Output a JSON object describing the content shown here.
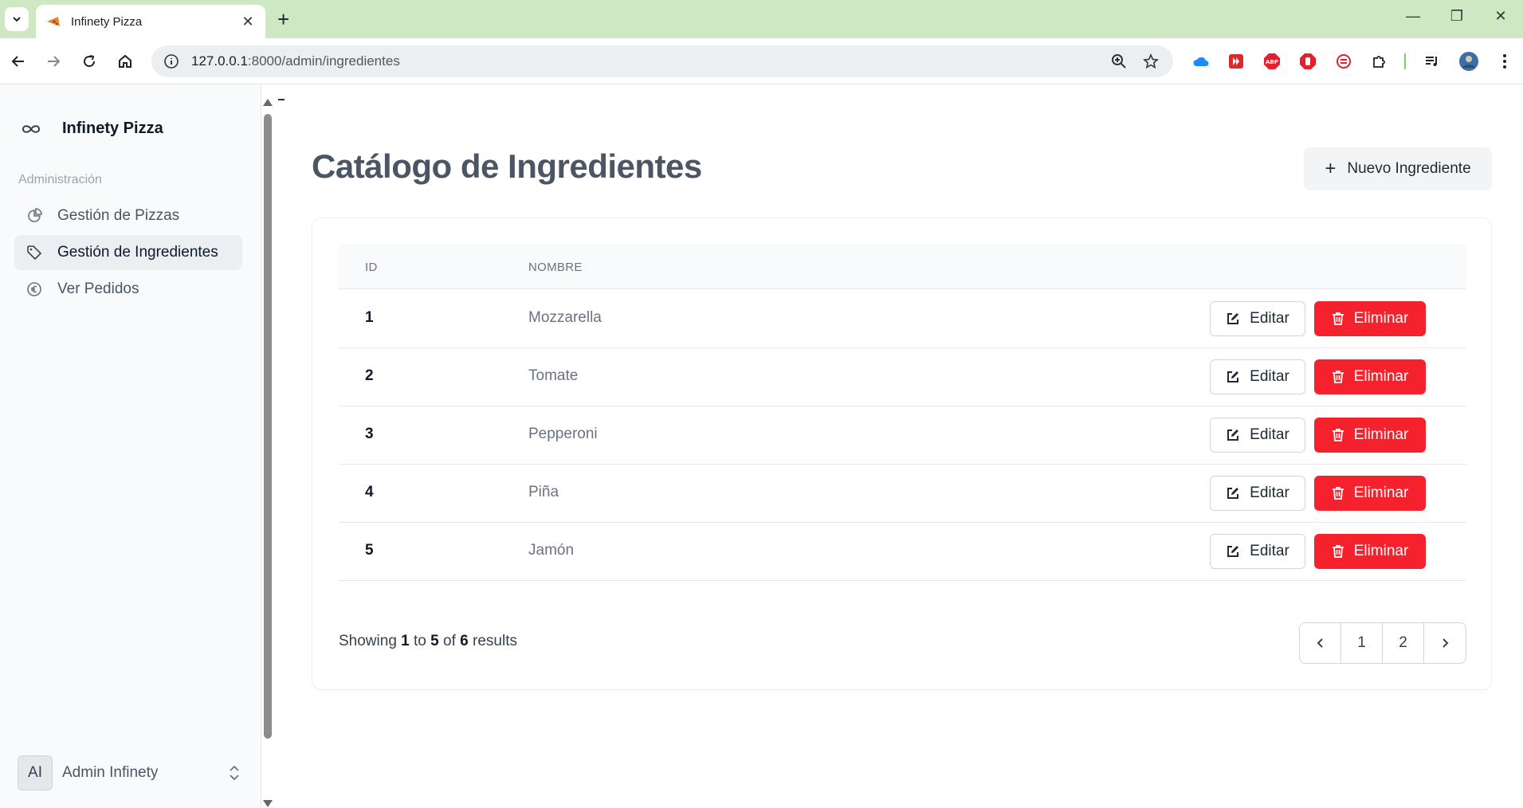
{
  "browser": {
    "tab_title": "Infinety Pizza",
    "url_host": "127.0.0.1",
    "url_path": ":8000/admin/ingredientes"
  },
  "sidebar": {
    "brand": "Infinety Pizza",
    "section": "Administración",
    "items": [
      {
        "label": "Gestión de Pizzas",
        "icon": "pie-chart-icon"
      },
      {
        "label": "Gestión de Ingredientes",
        "icon": "tag-icon",
        "active": true
      },
      {
        "label": "Ver Pedidos",
        "icon": "euro-icon"
      }
    ],
    "user": {
      "initials": "AI",
      "name": "Admin Infinety"
    }
  },
  "main": {
    "title": "Catálogo de Ingredientes",
    "new_button": "Nuevo Ingrediente",
    "columns": [
      "ID",
      "NOMBRE"
    ],
    "rows": [
      {
        "id": "1",
        "name": "Mozzarella"
      },
      {
        "id": "2",
        "name": "Tomate"
      },
      {
        "id": "3",
        "name": "Pepperoni"
      },
      {
        "id": "4",
        "name": "Piña"
      },
      {
        "id": "5",
        "name": "Jamón"
      }
    ],
    "edit_label": "Editar",
    "delete_label": "Eliminar",
    "showing": {
      "prefix": "Showing",
      "from": "1",
      "to_word": "to",
      "to": "5",
      "of_word": "of",
      "total": "6",
      "suffix": "results"
    },
    "pages": [
      "1",
      "2"
    ]
  },
  "colors": {
    "danger": "#f5222d",
    "accent_green": "#cfe8c4"
  }
}
